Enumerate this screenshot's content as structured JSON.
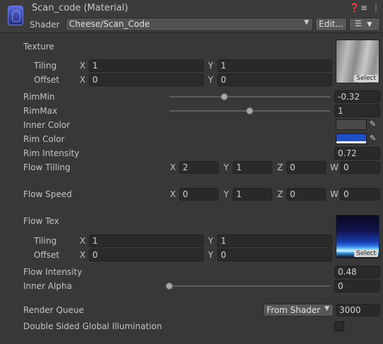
{
  "header": {
    "title": "Scan_code (Material)",
    "icons": [
      "help-icon",
      "settings-sliders-icon",
      "more-options-icon"
    ],
    "shader_label": "Shader",
    "shader_value": "Cheese/Scan_Code",
    "edit_label": "Edit...",
    "menu_icon": "list-menu-icon"
  },
  "texture": {
    "label": "Texture",
    "tiling_label": "Tiling",
    "offset_label": "Offset",
    "tiling_x": "1",
    "tiling_y": "1",
    "offset_x": "0",
    "offset_y": "0",
    "select_label": "Select"
  },
  "axes": {
    "x": "X",
    "y": "Y",
    "z": "Z",
    "w": "W"
  },
  "rim_min": {
    "label": "RimMin",
    "value": "-0.32",
    "slider_fraction": 0.34
  },
  "rim_max": {
    "label": "RimMax",
    "value": "1",
    "slider_fraction": 0.5
  },
  "inner_color": {
    "label": "Inner Color",
    "color": "#4a4a4a"
  },
  "rim_color": {
    "label": "Rim Color",
    "color": "#1e4fc8"
  },
  "rim_intensity": {
    "label": "Rim Intensity",
    "value": "0.72"
  },
  "flow_tilling": {
    "label": "Flow Tilling",
    "x": "2",
    "y": "1",
    "z": "0",
    "w": "0"
  },
  "flow_speed": {
    "label": "Flow Speed",
    "x": "0",
    "y": "1",
    "z": "0",
    "w": "0"
  },
  "flow_tex": {
    "label": "Flow Tex",
    "tiling_label": "Tiling",
    "offset_label": "Offset",
    "tiling_x": "1",
    "tiling_y": "1",
    "offset_x": "0",
    "offset_y": "0",
    "select_label": "Select"
  },
  "flow_intensity": {
    "label": "Flow Intensity",
    "value": "0.48"
  },
  "inner_alpha": {
    "label": "Inner Alpha",
    "value": "0",
    "slider_fraction": 0.0
  },
  "render_queue": {
    "label": "Render Queue",
    "mode": "From Shader",
    "value": "3000"
  },
  "double_sided_gi": {
    "label": "Double Sided Global Illumination",
    "checked": false
  }
}
